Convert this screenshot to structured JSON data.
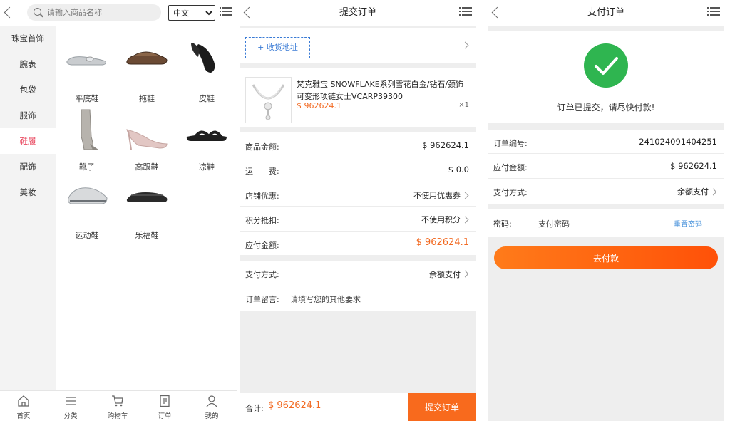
{
  "colors": {
    "accent": "#f86a1d",
    "active_category": "#e8435b",
    "link": "#3a8ad8",
    "success": "#2fb550"
  },
  "panel1": {
    "search_placeholder": "请输入商品名称",
    "language_options": [
      "中文"
    ],
    "language_selected": "中文",
    "categories": [
      "珠宝首饰",
      "腕表",
      "包袋",
      "服饰",
      "鞋履",
      "配饰",
      "美妆"
    ],
    "active_category": "鞋履",
    "products": [
      "平底鞋",
      "拖鞋",
      "皮鞋",
      "靴子",
      "高跟鞋",
      "凉鞋",
      "运动鞋",
      "乐福鞋"
    ],
    "tabbar": [
      {
        "label": "首页",
        "icon": "home-icon"
      },
      {
        "label": "分类",
        "icon": "list-icon"
      },
      {
        "label": "购物车",
        "icon": "cart-icon"
      },
      {
        "label": "订单",
        "icon": "order-icon"
      },
      {
        "label": "我的",
        "icon": "user-icon"
      }
    ]
  },
  "panel2": {
    "title": "提交订单",
    "address_button": "+ 收货地址",
    "item": {
      "name": "梵克雅宝 SNOWFLAKE系列雪花白金/钻石/颈饰可变形项链女士VCARP39300",
      "price": "$ 962624.1",
      "qty": "×1"
    },
    "rows": [
      {
        "label": "商品金额:",
        "value": "$ 962624.1"
      },
      {
        "label": "运　　费:",
        "value": "$ 0.0"
      },
      {
        "label": "店铺优惠:",
        "value": "不使用优惠券"
      },
      {
        "label": "积分抵扣:",
        "value": "不使用积分"
      },
      {
        "label": "应付金额:",
        "value": "$ 962624.1"
      }
    ],
    "payment_label": "支付方式:",
    "payment_value": "余额支付",
    "note_label": "订单留言:",
    "note_placeholder": "请填写您的其他要求",
    "total_label": "合计:",
    "total_value": "$ 962624.1",
    "submit_label": "提交订单"
  },
  "panel3": {
    "title": "支付订单",
    "status_text": "订单已提交，请尽快付款!",
    "rows": [
      {
        "label": "订单编号:",
        "value": "241024091404251"
      },
      {
        "label": "应付金额:",
        "value": "$ 962624.1"
      },
      {
        "label": "支付方式:",
        "value": "余额支付"
      }
    ],
    "password_label": "密码:",
    "password_placeholder": "支付密码",
    "reset_label": "重置密码",
    "pay_label": "去付款"
  }
}
